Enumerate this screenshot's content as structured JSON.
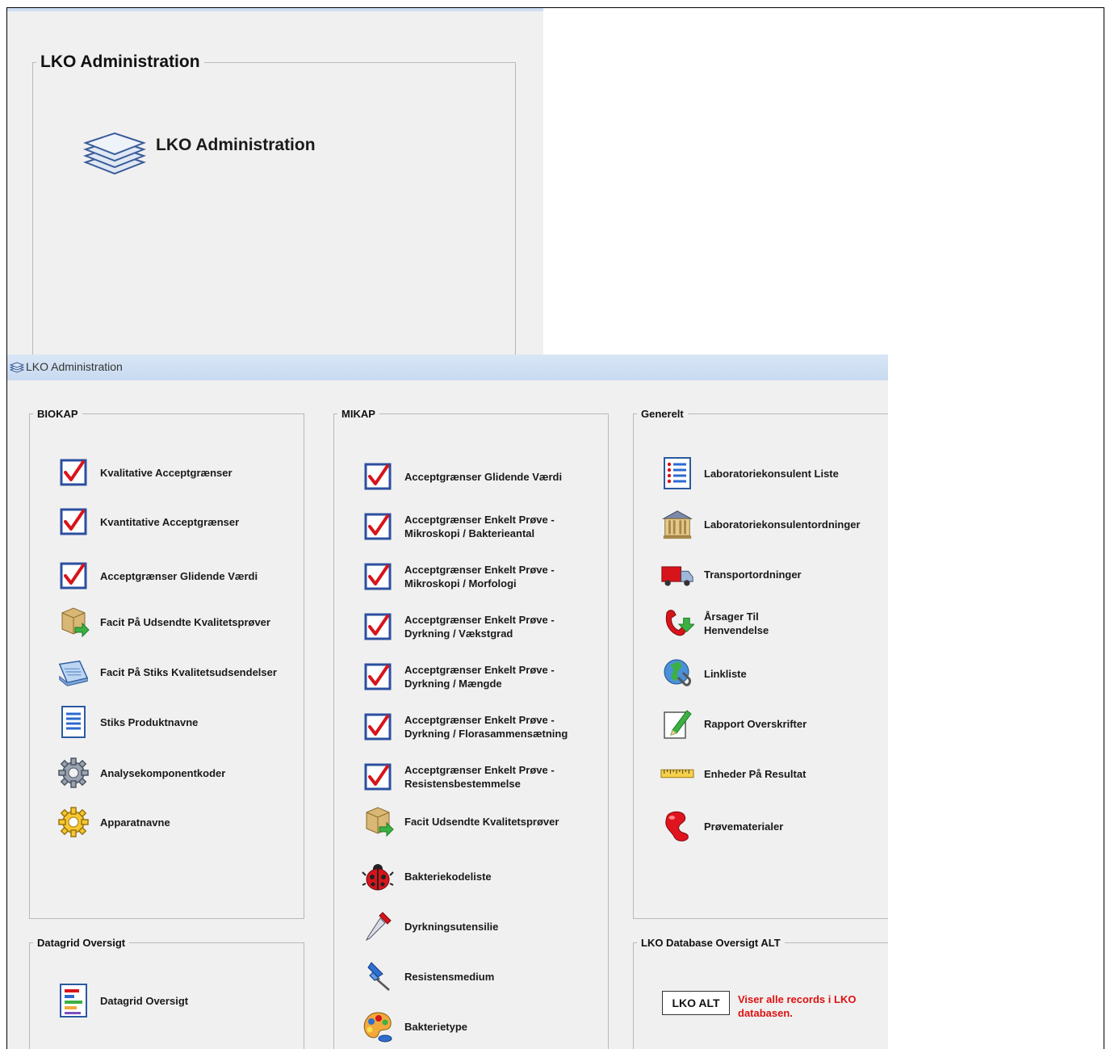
{
  "top": {
    "group_title": "LKO Administration",
    "link_label": "LKO Administration"
  },
  "window": {
    "title": "LKO Administration"
  },
  "biokap": {
    "title": "BIOKAP",
    "items": [
      {
        "label": "Kvalitative Acceptgrænser",
        "icon": "checkbox-icon"
      },
      {
        "label": "Kvantitative Acceptgrænser",
        "icon": "checkbox-icon"
      },
      {
        "label": "Acceptgrænser Glidende Værdi",
        "icon": "checkbox-icon"
      },
      {
        "label": "Facit På Udsendte Kvalitetsprøver",
        "icon": "package-icon"
      },
      {
        "label": "Facit På Stiks Kvalitetsudsendelser",
        "icon": "tray-icon"
      },
      {
        "label": "Stiks Produktnavne",
        "icon": "document-icon"
      },
      {
        "label": "Analysekomponentkoder",
        "icon": "gear-icon"
      },
      {
        "label": "Apparatnavne",
        "icon": "gear-yellow-icon"
      }
    ]
  },
  "mikap": {
    "title": "MIKAP",
    "items": [
      {
        "label": "Acceptgrænser Glidende Værdi",
        "icon": "checkbox-icon"
      },
      {
        "label": "Acceptgrænser Enkelt Prøve -\nMikroskopi / Bakterieantal",
        "icon": "checkbox-icon"
      },
      {
        "label": "Acceptgrænser Enkelt Prøve -\nMikroskopi / Morfologi",
        "icon": "checkbox-icon"
      },
      {
        "label": "Acceptgrænser Enkelt Prøve -\nDyrkning / Vækstgrad",
        "icon": "checkbox-icon"
      },
      {
        "label": "Acceptgrænser Enkelt Prøve -\nDyrkning / Mængde",
        "icon": "checkbox-icon"
      },
      {
        "label": "Acceptgrænser Enkelt Prøve -\nDyrkning / Florasammensætning",
        "icon": "checkbox-icon"
      },
      {
        "label": "Acceptgrænser Enkelt Prøve -\nResistensbestemmelse",
        "icon": "checkbox-icon"
      },
      {
        "label": "Facit Udsendte Kvalitetsprøver",
        "icon": "package-icon"
      },
      {
        "label": "Bakteriekodeliste",
        "icon": "ladybug-icon"
      },
      {
        "label": "Dyrkningsutensilie",
        "icon": "pipette-icon"
      },
      {
        "label": "Resistensmedium",
        "icon": "pushpin-icon"
      },
      {
        "label": "Bakterietype",
        "icon": "palette-icon"
      }
    ]
  },
  "generelt": {
    "title": "Generelt",
    "items": [
      {
        "label": "Laboratoriekonsulent Liste",
        "icon": "list-icon"
      },
      {
        "label": "Laboratoriekonsulentordninger",
        "icon": "building-icon"
      },
      {
        "label": "Transportordninger",
        "icon": "truck-icon"
      },
      {
        "label": "Årsager Til\nHenvendelse",
        "icon": "phone-icon"
      },
      {
        "label": "Linkliste",
        "icon": "globe-icon"
      },
      {
        "label": "Rapport Overskrifter",
        "icon": "pencil-icon"
      },
      {
        "label": "Enheder På Resultat",
        "icon": "ruler-icon"
      },
      {
        "label": "Prøvematerialer",
        "icon": "blob-icon"
      }
    ]
  },
  "datagrid": {
    "title": "Datagrid Oversigt",
    "item_label": "Datagrid Oversigt",
    "icon": "chart-doc-icon"
  },
  "lko_db": {
    "title": "LKO Database Oversigt ALT",
    "button_label": "LKO ALT",
    "description": "Viser alle records i LKO databasen."
  },
  "colors": {
    "window_bg": "#f0f0f0",
    "titlebar": "#cfdff2",
    "red_text": "#dd1111"
  }
}
